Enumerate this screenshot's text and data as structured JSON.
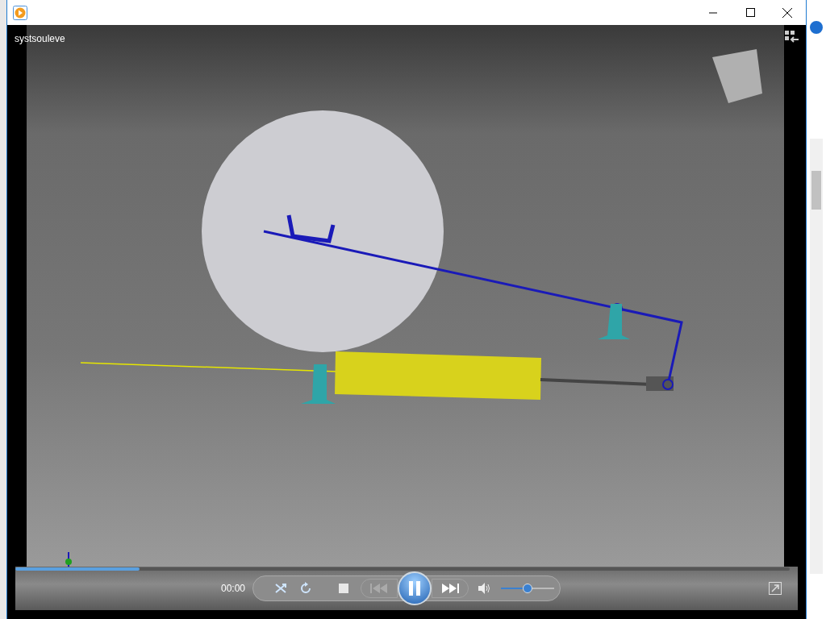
{
  "window": {
    "video_title": "systsouleve"
  },
  "player": {
    "time": "00:00",
    "playing": true,
    "seek": {
      "level": 0.16
    },
    "volume": {
      "level": 0.5
    }
  }
}
